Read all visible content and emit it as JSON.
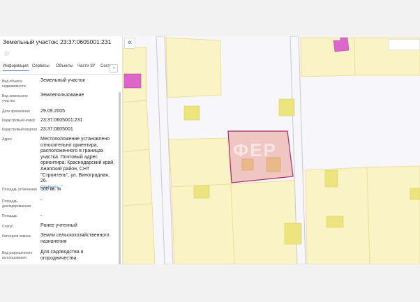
{
  "panel": {
    "title": "Земельный участок: 23:37:0605001:231",
    "tabs": [
      {
        "label": "Информация",
        "active": true
      },
      {
        "label": "Сервисы"
      },
      {
        "label": "Объекты"
      },
      {
        "label": "Части ЗУ"
      },
      {
        "label": "Состав"
      }
    ],
    "tab_next_label": "›",
    "fields": [
      {
        "label": "Вид объекта недвижимости",
        "value": "Земельный участок"
      },
      {
        "label": "Вид земельного участка",
        "value": "Землепользование"
      },
      {
        "label": "Дата присвоения",
        "value": "29.09.2005"
      },
      {
        "label": "Кадастровый номер",
        "value": "23:37:0605001:231"
      },
      {
        "label": "Кадастровый квартал",
        "value": "23:37:0605001"
      },
      {
        "label": "Адрес",
        "value": "Местоположение установлено относительно ориентира, расположенного в границах участка. Почтовый адрес ориентира: Краснодарский край, Анапский район, СНТ \"Строитель\", ул. Виноградная, 26.",
        "link": "Свернуть"
      },
      {
        "label": "Площадь уточненная",
        "value": "500 кв. м"
      },
      {
        "label": "Площадь декларированная",
        "value": "-"
      },
      {
        "label": "Площадь",
        "value": "-"
      },
      {
        "label": "Статус",
        "value": "Ранее учтенный"
      },
      {
        "label": "Категория земель",
        "value": "Земли сельскохозяйственного назначения"
      },
      {
        "label": "Вид разрешенного использования",
        "value": "Для садоводства и огородничества"
      }
    ]
  },
  "map": {
    "collapse_label": "«",
    "watermark": "ФЕР",
    "colors": {
      "parcel_fill": "#f9f3c6",
      "parcel_stroke": "#e8dfa0",
      "building_fill": "#ece47e",
      "selected_stroke": "#a0306e",
      "selected_fill": "#f0c6c2",
      "pink_building": "#dd66cc",
      "road": "#f6f6fb",
      "road_edge": "#c9c9c9"
    }
  }
}
